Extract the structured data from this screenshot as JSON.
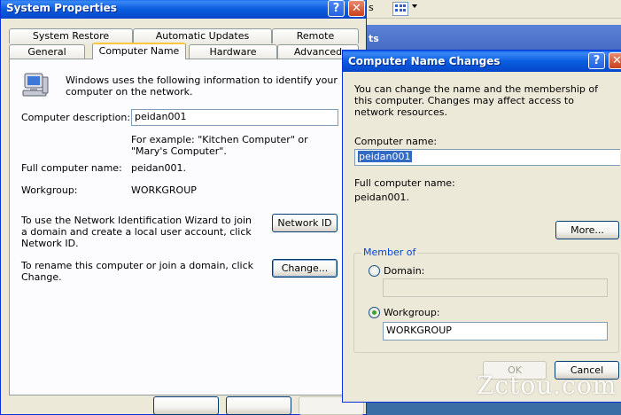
{
  "background_app": {
    "toolbar_fragment": "s",
    "header_fragment": "ts"
  },
  "system_properties": {
    "title": "System Properties",
    "help_glyph": "?",
    "close_glyph": "✕",
    "tabs_row1": [
      "System Restore",
      "Automatic Updates",
      "Remote"
    ],
    "tabs_row2": [
      "General",
      "Computer Name",
      "Hardware",
      "Advanced"
    ],
    "active_tab": "Computer Name",
    "intro": "Windows uses the following information to identify your computer on the network.",
    "description_label": "Computer description:",
    "description_value": "peidan001",
    "example": "For example: \"Kitchen Computer\" or \"Mary's Computer\".",
    "full_name_label": "Full computer name:",
    "full_name_value": "peidan001.",
    "workgroup_label": "Workgroup:",
    "workgroup_value": "WORKGROUP",
    "network_id_text": "To use the Network Identification Wizard to join a domain and create a local user account, click Network ID.",
    "network_id_button": "Network ID",
    "rename_text": "To rename this computer or join a domain, click Change.",
    "change_button": "Change..."
  },
  "name_changes": {
    "title": "Computer Name Changes",
    "help_glyph": "?",
    "close_glyph": "✕",
    "intro": "You can change the name and the membership of this computer. Changes may affect access to network resources.",
    "computer_name_label": "Computer name:",
    "computer_name_value": "peidan001",
    "full_name_label": "Full computer name:",
    "full_name_value": "peidan001.",
    "more_button": "More...",
    "member_of_label": "Member of",
    "domain_label": "Domain:",
    "domain_value": "",
    "workgroup_label": "Workgroup:",
    "workgroup_value": "WORKGROUP",
    "selected_membership": "workgroup",
    "ok_button": "OK",
    "cancel_button": "Cancel"
  },
  "watermark": "Zctou.com",
  "colors": {
    "desktop": "#3a6ea5",
    "titlebar": "#0b5ee0",
    "selection": "#316ac5",
    "legend": "#0046d5"
  }
}
